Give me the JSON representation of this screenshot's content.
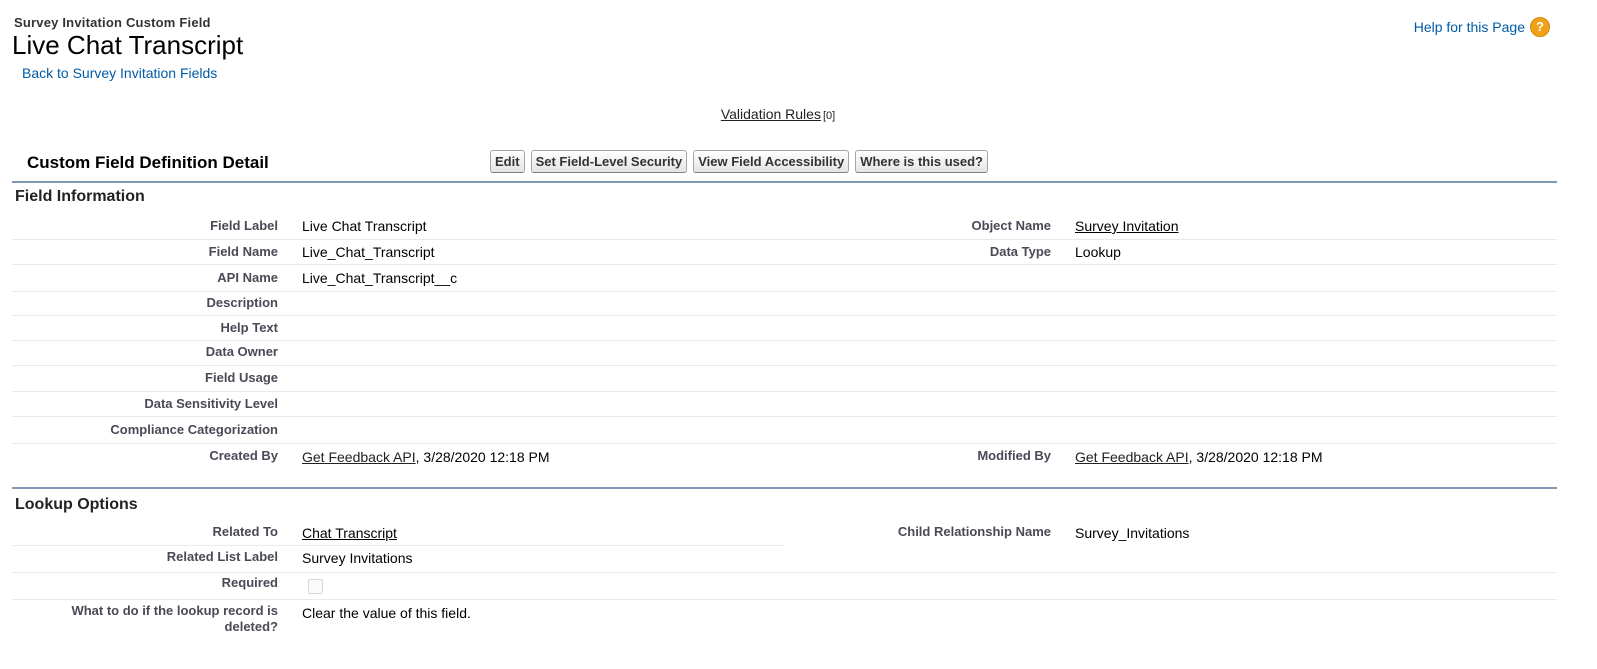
{
  "header": {
    "subtitle": "Survey Invitation Custom Field",
    "title": "Live Chat Transcript",
    "back_link": "Back to Survey Invitation Fields",
    "help_link": "Help for this Page",
    "help_icon": "?"
  },
  "validation": {
    "label": "Validation Rules",
    "count": "[0]"
  },
  "detail": {
    "title": "Custom Field Definition Detail",
    "buttons": {
      "edit": "Edit",
      "set_fls": "Set Field-Level Security",
      "view_access": "View Field Accessibility",
      "where_used": "Where is this used?"
    }
  },
  "field_info": {
    "heading": "Field Information",
    "field_label": {
      "label": "Field Label",
      "value": "Live Chat Transcript"
    },
    "object_name": {
      "label": "Object Name",
      "value": "Survey Invitation"
    },
    "field_name": {
      "label": "Field Name",
      "value": "Live_Chat_Transcript"
    },
    "data_type": {
      "label": "Data Type",
      "value": "Lookup"
    },
    "api_name": {
      "label": "API Name",
      "value": "Live_Chat_Transcript__c"
    },
    "description": {
      "label": "Description",
      "value": ""
    },
    "help_text": {
      "label": "Help Text",
      "value": ""
    },
    "data_owner": {
      "label": "Data Owner",
      "value": ""
    },
    "field_usage": {
      "label": "Field Usage",
      "value": ""
    },
    "data_sensitivity": {
      "label": "Data Sensitivity Level",
      "value": ""
    },
    "compliance": {
      "label": "Compliance Categorization",
      "value": ""
    },
    "created_by": {
      "label": "Created By",
      "user": "Get Feedback API",
      "date": ", 3/28/2020 12:18 PM"
    },
    "modified_by": {
      "label": "Modified By",
      "user": "Get Feedback API",
      "date": ", 3/28/2020 12:18 PM"
    }
  },
  "lookup_options": {
    "heading": "Lookup Options",
    "related_to": {
      "label": "Related To",
      "value": "Chat Transcript"
    },
    "child_rel": {
      "label": "Child Relationship Name",
      "value": "Survey_Invitations"
    },
    "related_list_label": {
      "label": "Related List Label",
      "value": "Survey Invitations"
    },
    "required": {
      "label": "Required",
      "checked": false
    },
    "on_delete": {
      "label_line1": "What to do if the lookup record is",
      "label_line2": "deleted?",
      "value": "Clear the value of this field."
    }
  },
  "colors": {
    "link": "#015ba7",
    "section_rule": "#8197b3",
    "help_icon": "#f0a11a"
  }
}
